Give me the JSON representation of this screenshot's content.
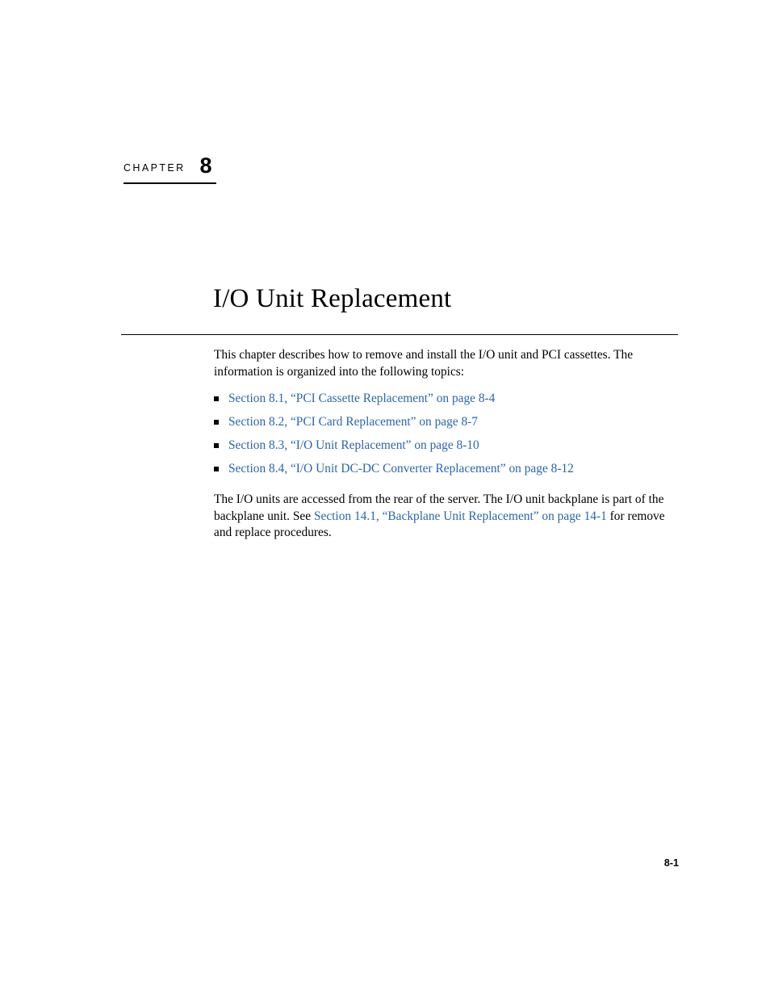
{
  "chapter": {
    "label": "CHAPTER",
    "number": "8"
  },
  "title": "I/O Unit Replacement",
  "intro_paragraph": "This chapter describes how to remove and install the I/O unit and PCI cassettes. The information is organized into the following topics:",
  "topics": [
    {
      "text": "Section 8.1, “PCI Cassette Replacement” on page 8-4"
    },
    {
      "text": "Section 8.2, “PCI Card Replacement” on page 8-7"
    },
    {
      "text": "Section 8.3, “I/O Unit Replacement” on page 8-10"
    },
    {
      "text": "Section 8.4, “I/O Unit DC-DC Converter Replacement” on page 8-12"
    }
  ],
  "closing_paragraph": {
    "before_link": "The I/O units are accessed from the rear of the server. The I/O unit backplane is part of the backplane unit. See ",
    "link": "Section 14.1, “Backplane Unit Replacement” on page 14-1",
    "after_link": " for remove and replace procedures."
  },
  "footer": {
    "page_number": "8-1"
  },
  "colors": {
    "link": "#2c66a8",
    "text": "#000000",
    "background": "#ffffff"
  }
}
